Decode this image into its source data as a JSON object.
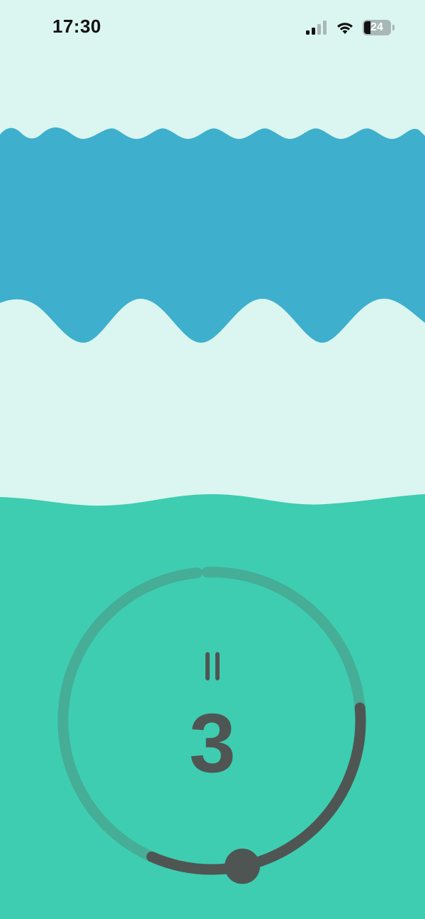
{
  "status_bar": {
    "time": "17:30",
    "battery_level": "24",
    "signal_icon": "cellular-signal-icon",
    "wifi_icon": "wifi-icon",
    "battery_icon": "battery-icon"
  },
  "colors": {
    "background": "#dbf5f0",
    "upper_wave": "#3eafcc",
    "lower_water": "#3ecdb0",
    "ring_track": "#46ad97",
    "ring_progress": "#4f5553"
  },
  "timer": {
    "count": "3",
    "progress_fraction": 0.33,
    "pause_icon": "pause-icon",
    "slider_icon": "slider-knob"
  }
}
